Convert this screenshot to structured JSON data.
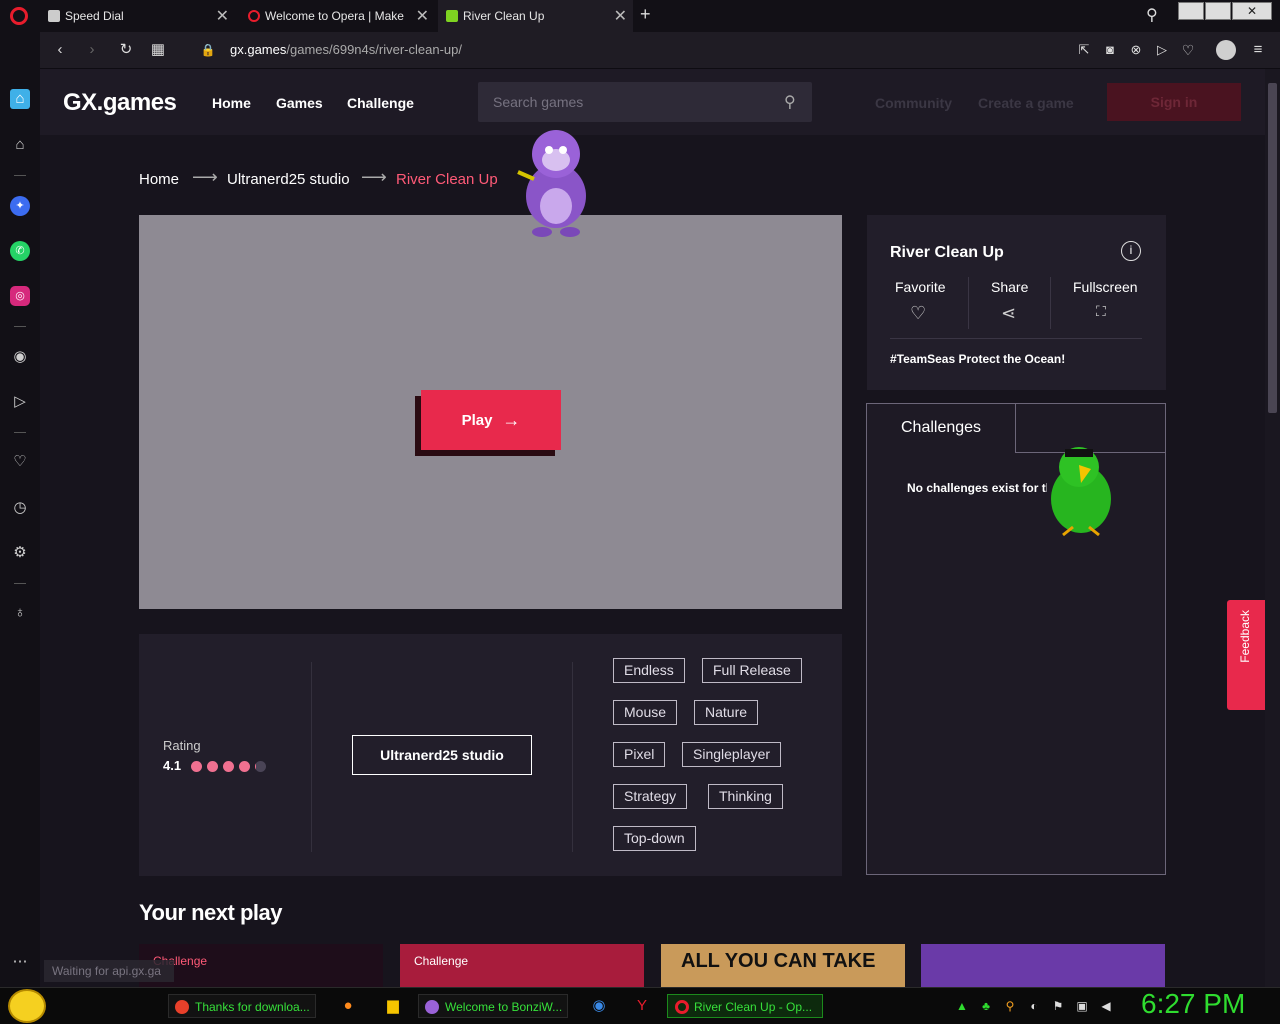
{
  "browser": {
    "tabs": [
      {
        "label": "Speed Dial",
        "active": false
      },
      {
        "label": "Welcome to Opera | Make",
        "active": false
      },
      {
        "label": "River Clean Up",
        "active": true
      }
    ],
    "url_host": "gx.games",
    "url_path": "/games/699n4s/river-clean-up/",
    "new_tab": "+"
  },
  "site": {
    "logo": "GX.games",
    "nav": {
      "home": "Home",
      "games": "Games",
      "challenge": "Challenge"
    },
    "search_placeholder": "Search games",
    "community": "Community",
    "create": "Create a game",
    "signin": "Sign in"
  },
  "breadcrumb": {
    "home": "Home",
    "studio": "Ultranerd25 studio",
    "current": "River Clean Up",
    "sep": "⟶"
  },
  "game": {
    "play_label": "Play",
    "title": "River Clean Up",
    "actions": {
      "favorite": "Favorite",
      "share": "Share",
      "fullscreen": "Fullscreen"
    },
    "tags_line": "#TeamSeas Protect the Ocean!"
  },
  "challenges": {
    "tab": "Challenges",
    "empty": "No challenges exist for th"
  },
  "details": {
    "rating_label": "Rating",
    "rating_value": "4.1",
    "studio": "Ultranerd25 studio",
    "tags": [
      "Endless",
      "Full Release",
      "Mouse",
      "Nature",
      "Pixel",
      "Singleplayer",
      "Strategy",
      "Thinking",
      "Top-down"
    ]
  },
  "next_play": {
    "title": "Your next play",
    "thumb1_badge": "Challenge",
    "thumb2_badge": "Challenge",
    "thumb3_text": "ALL YOU CAN TAKE"
  },
  "feedback": "Feedback",
  "status_text": "Waiting for api.gx.ga",
  "taskbar": {
    "items": [
      {
        "label": "Thanks for downloa..."
      },
      {
        "label": "Welcome to BonziW..."
      },
      {
        "label": "River Clean Up - Op..."
      }
    ],
    "clock": "6:27 PM"
  },
  "colors": {
    "accent": "#e8294c",
    "breadcrumb_current": "#ff5a77",
    "clock": "#2fdc2f"
  }
}
